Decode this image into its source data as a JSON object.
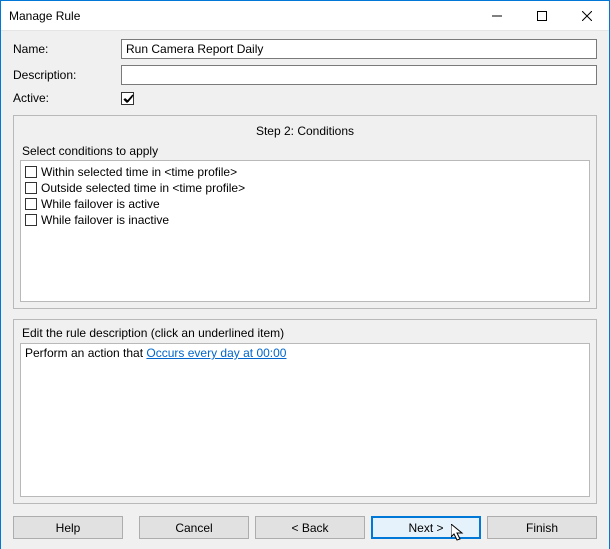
{
  "window": {
    "title": "Manage Rule"
  },
  "form": {
    "name_label": "Name:",
    "name_value": "Run Camera Report Daily",
    "description_label": "Description:",
    "description_value": "",
    "active_label": "Active:",
    "active_checked": true
  },
  "step": {
    "title": "Step 2: Conditions",
    "select_label": "Select conditions to apply",
    "conditions": [
      {
        "label": "Within selected time in <time profile>",
        "checked": false
      },
      {
        "label": "Outside selected time in <time profile>",
        "checked": false
      },
      {
        "label": "While failover is active",
        "checked": false
      },
      {
        "label": "While failover is inactive",
        "checked": false
      }
    ]
  },
  "description": {
    "edit_label": "Edit the rule description (click an underlined item)",
    "prefix": "Perform an action that ",
    "link_text": "Occurs every day at 00:00"
  },
  "buttons": {
    "help": "Help",
    "cancel": "Cancel",
    "back": "< Back",
    "next": "Next >",
    "finish": "Finish"
  }
}
